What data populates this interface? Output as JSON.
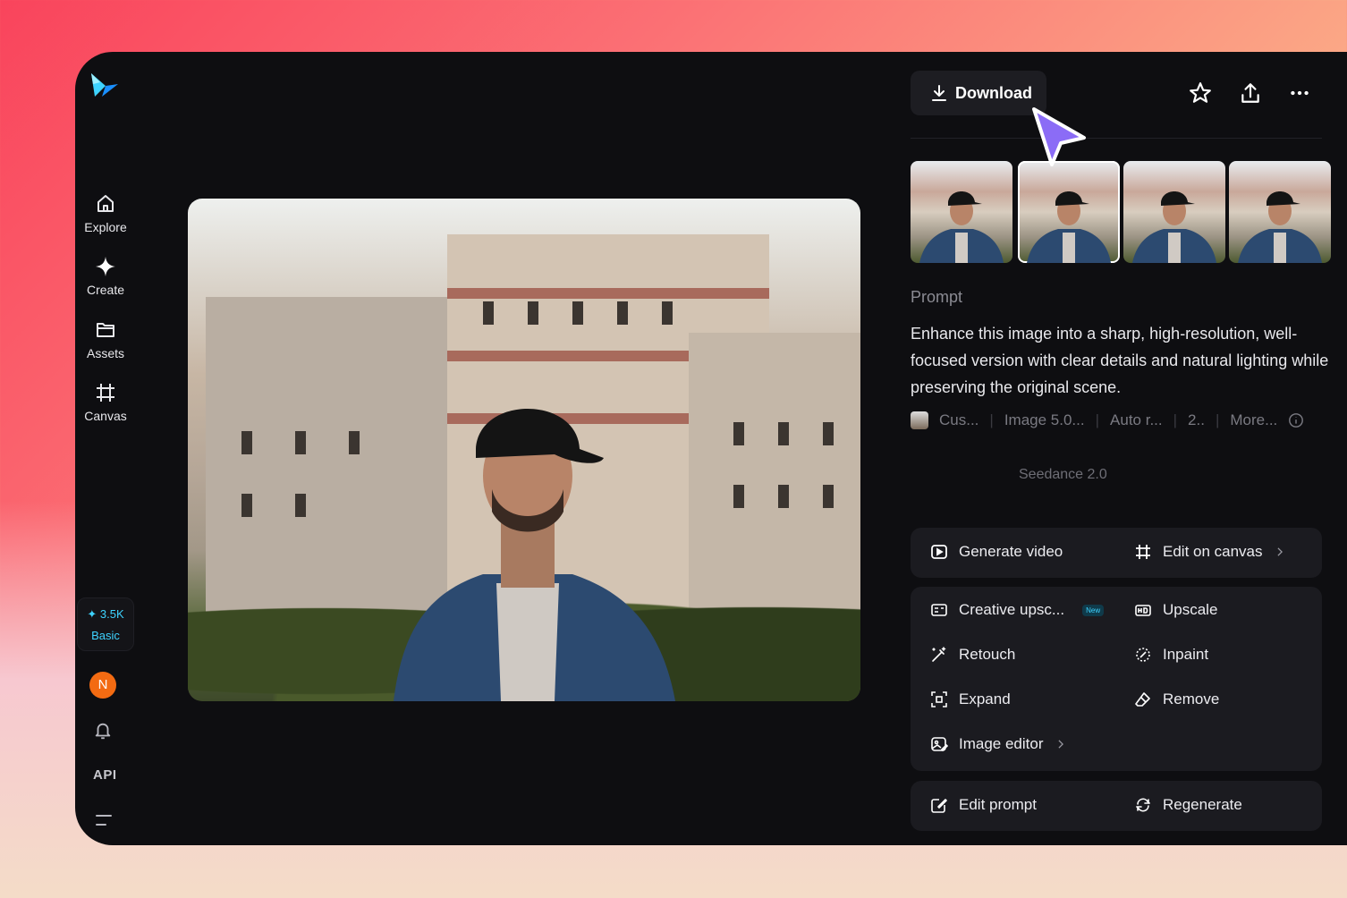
{
  "sidebar": {
    "items": [
      {
        "label": "Explore",
        "icon": "home-icon"
      },
      {
        "label": "Create",
        "icon": "sparkle-icon"
      },
      {
        "label": "Assets",
        "icon": "folder-icon"
      },
      {
        "label": "Canvas",
        "icon": "canvas-icon"
      }
    ],
    "credits": "3.5K",
    "tier": "Basic",
    "avatar_initial": "N",
    "api_label": "API"
  },
  "toolbar": {
    "download_label": "Download"
  },
  "prompt": {
    "label": "Prompt",
    "text": "Enhance this image into a sharp, high-resolution, well-focused version with clear details and natural lighting while preserving the original scene.",
    "meta": [
      "Cus...",
      "Image 5.0...",
      "Auto r...",
      "2..",
      "More..."
    ],
    "model": "Seedance 2.0"
  },
  "actions": {
    "generate_video": "Generate video",
    "edit_on_canvas": "Edit on canvas",
    "creative_upscale": "Creative upsc...",
    "new_badge": "New",
    "upscale": "Upscale",
    "retouch": "Retouch",
    "inpaint": "Inpaint",
    "expand": "Expand",
    "remove": "Remove",
    "image_editor": "Image editor",
    "edit_prompt": "Edit prompt",
    "regenerate": "Regenerate"
  },
  "colors": {
    "accent": "#3ed3ff",
    "avatar": "#f36b12",
    "cursor": "#8b6cf6"
  }
}
